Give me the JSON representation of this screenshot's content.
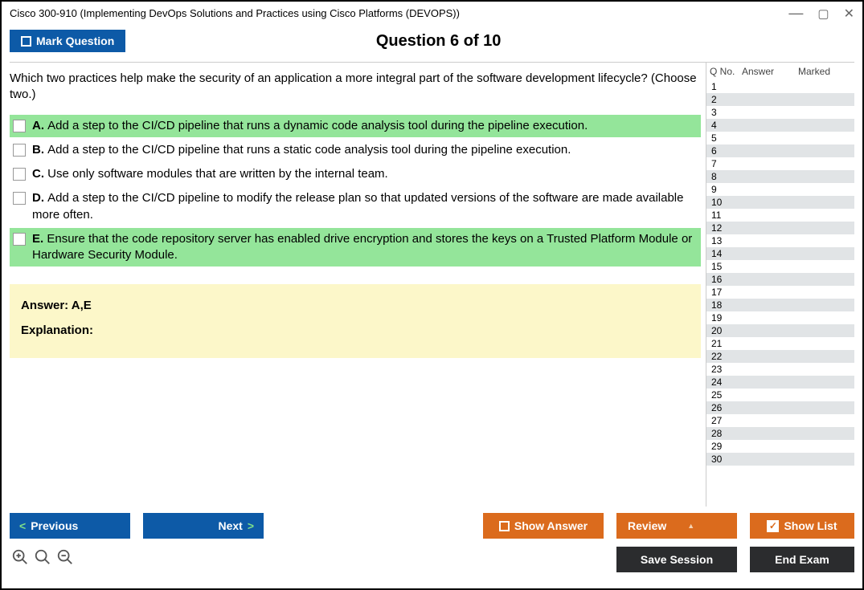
{
  "window": {
    "title": "Cisco 300-910 (Implementing DevOps Solutions and Practices using Cisco Platforms (DEVOPS))"
  },
  "header": {
    "mark_label": "Mark Question",
    "question_heading": "Question 6 of 10"
  },
  "question": {
    "text": "Which two practices help make the security of an application a more integral part of the software development lifecycle? (Choose two.)",
    "options": [
      {
        "label": "A.",
        "text": "Add a step to the CI/CD pipeline that runs a dynamic code analysis tool during the pipeline execution.",
        "highlight": true
      },
      {
        "label": "B.",
        "text": "Add a step to the CI/CD pipeline that runs a static code analysis tool during the pipeline execution.",
        "highlight": false
      },
      {
        "label": "C.",
        "text": "Use only software modules that are written by the internal team.",
        "highlight": false
      },
      {
        "label": "D.",
        "text": "Add a step to the CI/CD pipeline to modify the release plan so that updated versions of the software are made available more often.",
        "highlight": false
      },
      {
        "label": "E.",
        "text": "Ensure that the code repository server has enabled drive encryption and stores the keys on a Trusted Platform Module or Hardware Security Module.",
        "highlight": true
      }
    ]
  },
  "answer_panel": {
    "answer": "Answer: A,E",
    "explanation_label": "Explanation:"
  },
  "sidebar": {
    "col_qno": "Q No.",
    "col_answer": "Answer",
    "col_marked": "Marked",
    "rows": [
      {
        "n": "1"
      },
      {
        "n": "2"
      },
      {
        "n": "3"
      },
      {
        "n": "4"
      },
      {
        "n": "5"
      },
      {
        "n": "6"
      },
      {
        "n": "7"
      },
      {
        "n": "8"
      },
      {
        "n": "9"
      },
      {
        "n": "10"
      },
      {
        "n": "11"
      },
      {
        "n": "12"
      },
      {
        "n": "13"
      },
      {
        "n": "14"
      },
      {
        "n": "15"
      },
      {
        "n": "16"
      },
      {
        "n": "17"
      },
      {
        "n": "18"
      },
      {
        "n": "19"
      },
      {
        "n": "20"
      },
      {
        "n": "21"
      },
      {
        "n": "22"
      },
      {
        "n": "23"
      },
      {
        "n": "24"
      },
      {
        "n": "25"
      },
      {
        "n": "26"
      },
      {
        "n": "27"
      },
      {
        "n": "28"
      },
      {
        "n": "29"
      },
      {
        "n": "30"
      }
    ]
  },
  "footer": {
    "previous": "Previous",
    "next": "Next",
    "show_answer": "Show Answer",
    "review": "Review",
    "show_list": "Show List",
    "save_session": "Save Session",
    "end_exam": "End Exam"
  },
  "colors": {
    "highlight_green": "#94e59a",
    "answer_yellow": "#fcf7c9",
    "blue": "#0d5aa7",
    "orange": "#db6b1d",
    "dark": "#2b2c2e"
  }
}
